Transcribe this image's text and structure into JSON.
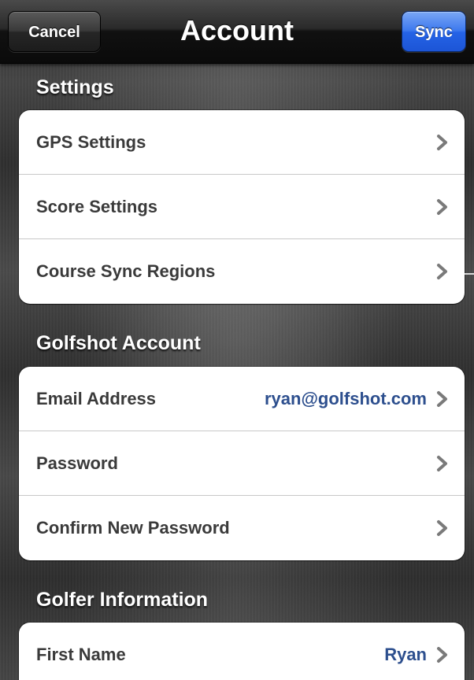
{
  "navbar": {
    "title": "Account",
    "cancel_label": "Cancel",
    "sync_label": "Sync"
  },
  "sections": {
    "settings": {
      "header": "Settings",
      "rows": [
        {
          "label": "GPS Settings",
          "value": ""
        },
        {
          "label": "Score Settings",
          "value": ""
        },
        {
          "label": "Course Sync Regions",
          "value": ""
        }
      ]
    },
    "account": {
      "header": "Golfshot Account",
      "rows": [
        {
          "label": "Email Address",
          "value": "ryan@golfshot.com"
        },
        {
          "label": "Password",
          "value": ""
        },
        {
          "label": "Confirm New Password",
          "value": ""
        }
      ]
    },
    "golfer": {
      "header": "Golfer Information",
      "rows": [
        {
          "label": "First Name",
          "value": "Ryan"
        }
      ]
    }
  },
  "icons": {
    "disclosure": "chevron-right-icon"
  },
  "colors": {
    "sync_button": "#2563e6",
    "value_text": "#2d4f8e",
    "label_text": "#3a3a3a"
  }
}
